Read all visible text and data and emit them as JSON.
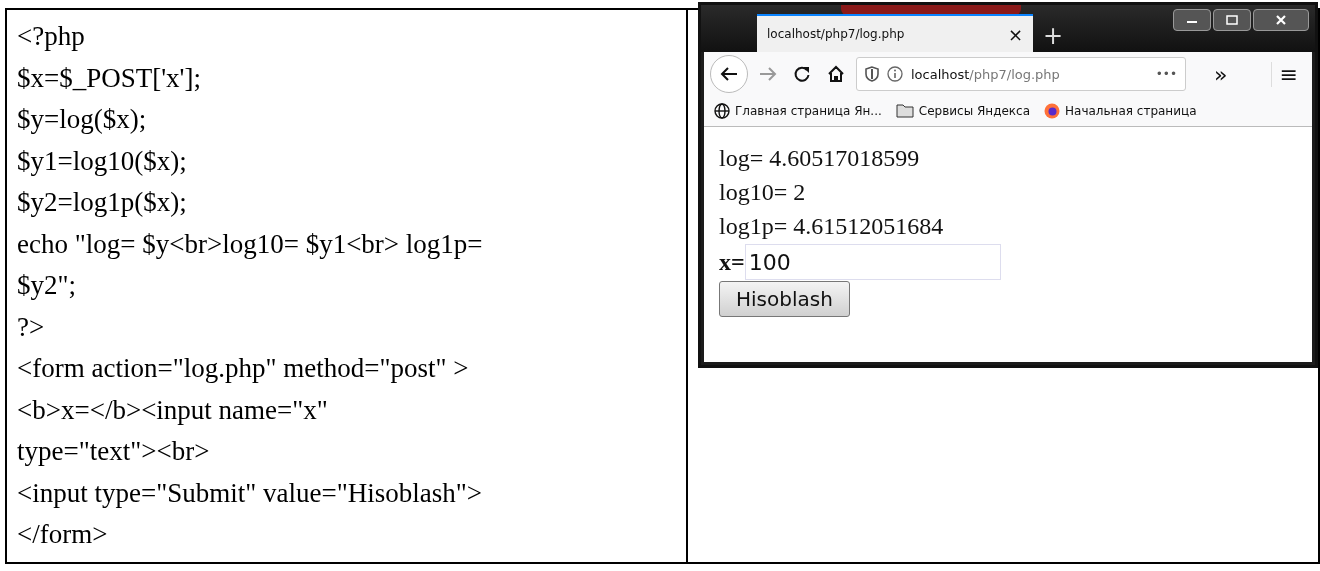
{
  "code_lines": [
    "<?php",
    "$x=$_POST['x'];",
    "$y=log($x);",
    "$y1=log10($x);",
    "$y2=log1p($x);",
    "echo \"log= $y<br>log10= $y1<br> log1p=",
    "$y2\";",
    "?>",
    "<form action=\"log.php\" method=\"post\" >",
    "<b>x=</b><input name=\"x\"",
    "type=\"text\"><br>",
    "<input type=\"Submit\" value=\"Hisoblash\">",
    "</form>"
  ],
  "browser": {
    "tab": {
      "title": "localhost/php7/log.php",
      "close": "×",
      "new_tab": "+"
    },
    "address": {
      "host": "localhost",
      "path": "/php7/log.php",
      "more": "•••"
    },
    "overflow": "»",
    "menu": "≡",
    "bookmarks": [
      {
        "kind": "globe",
        "label": "Главная страница Ян..."
      },
      {
        "kind": "folder",
        "label": "Сервисы Яндекса"
      },
      {
        "kind": "firefox",
        "label": "Начальная страница"
      }
    ],
    "output_lines": [
      "log= 4.60517018599",
      "log10= 2",
      "log1p= 4.61512051684"
    ],
    "form": {
      "label": "x=",
      "value": "100",
      "button": "Hisoblash"
    }
  }
}
